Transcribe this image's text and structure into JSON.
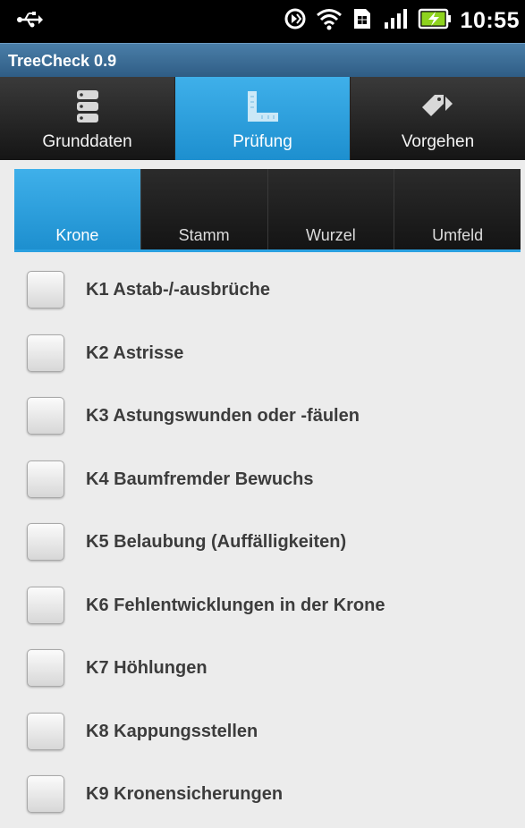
{
  "status_bar": {
    "time": "10:55",
    "icons": [
      "usb-icon",
      "sync-icon",
      "wifi-icon",
      "sim-icon",
      "signal-icon",
      "battery-charging-icon"
    ]
  },
  "app": {
    "title": "TreeCheck 0.9"
  },
  "main_tabs": [
    {
      "label": "Grunddaten",
      "icon": "database-icon",
      "active": false
    },
    {
      "label": "Prüfung",
      "icon": "ruler-icon",
      "active": true
    },
    {
      "label": "Vorgehen",
      "icon": "tag-arrow-icon",
      "active": false
    }
  ],
  "sub_tabs": [
    {
      "label": "Krone",
      "active": true
    },
    {
      "label": "Stamm",
      "active": false
    },
    {
      "label": "Wurzel",
      "active": false
    },
    {
      "label": "Umfeld",
      "active": false
    }
  ],
  "checklist": [
    {
      "label": "K1 Astab-/-ausbrüche",
      "checked": false
    },
    {
      "label": "K2 Astrisse",
      "checked": false
    },
    {
      "label": "K3 Astungswunden oder -fäulen",
      "checked": false
    },
    {
      "label": "K4 Baumfremder Bewuchs",
      "checked": false
    },
    {
      "label": "K5 Belaubung (Auffälligkeiten)",
      "checked": false
    },
    {
      "label": "K6 Fehlentwicklungen in der Krone",
      "checked": false
    },
    {
      "label": "K7 Höhlungen",
      "checked": false
    },
    {
      "label": "K8 Kappungsstellen",
      "checked": false
    },
    {
      "label": "K9 Kronensicherungen",
      "checked": false
    }
  ],
  "colors": {
    "accent": "#2aa0e0",
    "title_bar": "#3b6d96",
    "tab_bar": "#1e1e1e",
    "background": "#ececec"
  }
}
